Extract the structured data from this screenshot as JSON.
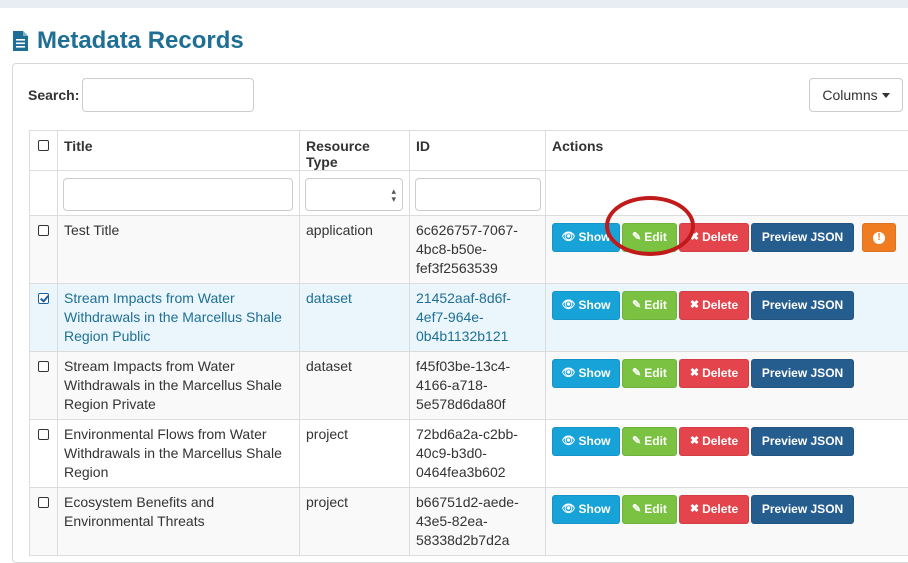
{
  "page": {
    "title": "Metadata Records"
  },
  "search": {
    "label": "Search:",
    "value": ""
  },
  "columns_button": {
    "label": "Columns"
  },
  "table": {
    "headers": {
      "title": "Title",
      "resource_type": "Resource Type",
      "id": "ID",
      "actions": "Actions"
    },
    "rows": [
      {
        "title": "Test Title",
        "resource_type": "application",
        "id": "6c626757-7067-4bc8-b50e-fef3f2563539",
        "selected": false,
        "has_alert": true
      },
      {
        "title": "Stream Impacts from Water Withdrawals in the Marcellus Shale Region Public",
        "resource_type": "dataset",
        "id": "21452aaf-8d6f-4ef7-964e-0b4b1132b121",
        "selected": true,
        "has_alert": false
      },
      {
        "title": "Stream Impacts from Water Withdrawals in the Marcellus Shale Region Private",
        "resource_type": "dataset",
        "id": "f45f03be-13c4-4166-a718-5e578d6da80f",
        "selected": false,
        "has_alert": false
      },
      {
        "title": "Environmental Flows from Water Withdrawals in the Marcellus Shale Region",
        "resource_type": "project",
        "id": "72bd6a2a-c2bb-40c9-b3d0-0464fea3b602",
        "selected": false,
        "has_alert": false
      },
      {
        "title": "Ecosystem Benefits and Environmental Threats",
        "resource_type": "project",
        "id": "b66751d2-aede-43e5-82ea-58338d2b7d2a",
        "selected": false,
        "has_alert": false
      }
    ]
  },
  "actions": {
    "show": "Show",
    "edit": "Edit",
    "delete": "Delete",
    "preview": "Preview JSON"
  },
  "colors": {
    "title": "#1f6f94",
    "show": "#17a2d8",
    "edit": "#7bc242",
    "delete": "#e4444c",
    "preview": "#265d8f",
    "alert": "#f07c22",
    "highlight": "#c01a1a"
  }
}
